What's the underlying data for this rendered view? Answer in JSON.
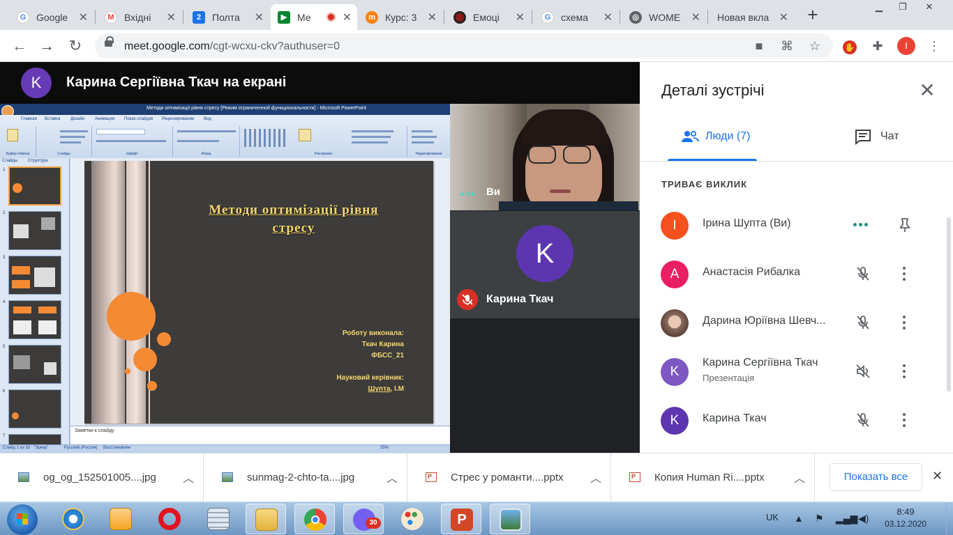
{
  "browser": {
    "tabs": [
      {
        "title": "Google",
        "icon": "google-icon",
        "color": "#4285f4"
      },
      {
        "title": "Вхідні",
        "icon": "gmail-icon",
        "color": "#ea4335"
      },
      {
        "title": "Полта",
        "icon": "calendar-2-icon",
        "color": "#1a73e8"
      },
      {
        "title": "Ме",
        "icon": "meet-icon",
        "color": "#00832d"
      },
      {
        "title": "Курс: 3",
        "icon": "moodle-icon",
        "color": "#f98012"
      },
      {
        "title": "Емоці",
        "icon": "record-icon",
        "color": "#8b1a1a"
      },
      {
        "title": "схема",
        "icon": "google-icon",
        "color": "#4285f4"
      },
      {
        "title": "WOME",
        "icon": "globe-icon",
        "color": "#5f6368"
      },
      {
        "title": "Новая вкла",
        "icon": "",
        "color": ""
      }
    ],
    "new_tab_glyph": "+",
    "url_host": "meet.google.com",
    "url_path": "/cgt-wcxu-ckv?authuser=0",
    "profile_initial": "I"
  },
  "meet": {
    "presenter_initial": "K",
    "presenter_title": "Карина Сергіївна Ткач на екрані",
    "self_label": "Ви",
    "tile_initial": "K",
    "tile_name": "Карина Ткач"
  },
  "slide": {
    "window_title": "Методи оптимізації рівня стресу [Режим ограниченной функциональности] - Microsoft PowerPoint",
    "ribbon_tabs": [
      "Главная",
      "Вставка",
      "Дизайн",
      "Анимация",
      "Показ слайдов",
      "Рецензирование",
      "Вид"
    ],
    "ribbon_groups": [
      "Буфер обмена",
      "Слайды",
      "Шрифт",
      "Абзац",
      "Рисование",
      "Редактирование"
    ],
    "panel_tabs": [
      "Слайды",
      "Структура"
    ],
    "title_line1": "Методи оптимізації рівня",
    "title_line2": "стресу",
    "author_label": "Роботу виконала:",
    "author_name": "Ткач Карина",
    "group": "ФБСС_21",
    "advisor_label": "Науковий керівник:",
    "advisor_surname": "Шупта",
    "advisor_initials": ", І.М",
    "notes_placeholder": "Заметки к слайду",
    "status_slide": "Слайд 1 из 33",
    "status_theme": "\"Эркер\"",
    "status_lang": "Русский (Россия)",
    "status_restore": "Восстановлен",
    "status_zoom": "35%"
  },
  "panel": {
    "title": "Деталі зустрічі",
    "tab_people": "Люди (7)",
    "tab_chat": "Чат",
    "section": "ТРИВАЄ ВИКЛИК",
    "participants": [
      {
        "initial": "I",
        "name": "Ірина Шупта (Ви)",
        "sub": "",
        "color": "#f4511e"
      },
      {
        "initial": "A",
        "name": "Анастасія Рибалка",
        "sub": "",
        "color": "#e91e63"
      },
      {
        "initial": "",
        "name": "Дарина Юріївна Шевч...",
        "sub": "",
        "color": "#8d6e63"
      },
      {
        "initial": "K",
        "name": "Карина Сергіївна Ткач",
        "sub": "Презентація",
        "color": "#7e57c2"
      },
      {
        "initial": "K",
        "name": "Карина Ткач",
        "sub": "",
        "color": "#5e35b1"
      }
    ],
    "close_glyph": "✕"
  },
  "downloads": {
    "items": [
      {
        "name": "og_og_152501005....jpg",
        "type": "image"
      },
      {
        "name": "sunmag-2-chto-ta....jpg",
        "type": "image"
      },
      {
        "name": "Стрес у романти....pptx",
        "type": "pptx"
      },
      {
        "name": "Копия Human Ri....pptx",
        "type": "pptx"
      }
    ],
    "show_all": "Показать все"
  },
  "taskbar": {
    "lang": "UK",
    "time": "8:49",
    "date": "03.12.2020",
    "viber_badge": "30"
  }
}
